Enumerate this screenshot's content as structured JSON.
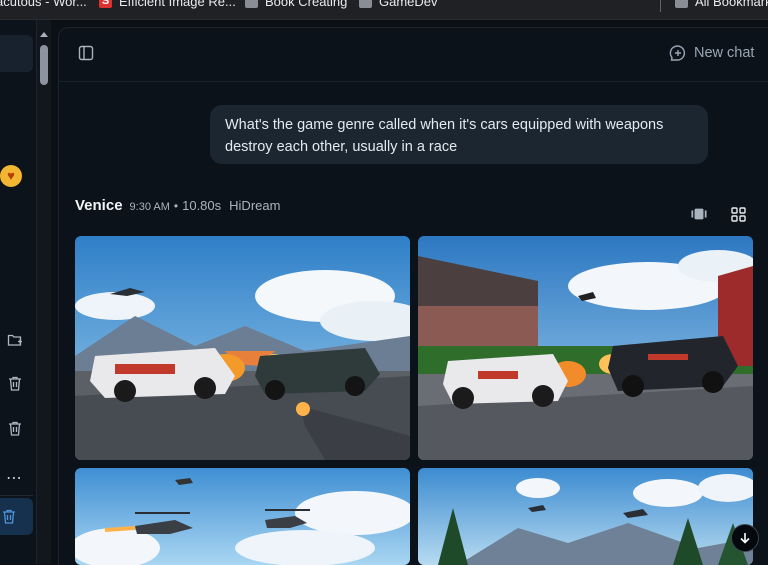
{
  "bookmarks": [
    {
      "label": "acutous - Wor...",
      "icon": "folder-icon"
    },
    {
      "label": "Efficient Image Re...",
      "icon": "s-logo-icon"
    },
    {
      "label": "Book Creating",
      "icon": "folder-icon"
    },
    {
      "label": "GameDev",
      "icon": "folder-icon"
    },
    {
      "label": "All Bookmarks",
      "icon": "folder-icon"
    }
  ],
  "header": {
    "new_chat_label": "New chat"
  },
  "user_message": "What's the game genre called when it's cars equipped with weapons destroy each other, usually in a race",
  "assistant": {
    "name": "Venice",
    "time": "9:30 AM",
    "separator": "•",
    "duration": "10.80s",
    "model": "HiDream"
  },
  "images": [
    {
      "alt": "Race cars with mounted guns racing past helicopters and explosions"
    },
    {
      "alt": "Armed race cars on a stadium racetrack with fire and sparks"
    },
    {
      "alt": "Helicopter gunships over a race scene"
    },
    {
      "alt": "Mountain race track with drones and pine trees"
    }
  ],
  "colors": {
    "accent": "#4f93d9",
    "panel": "#0c1219",
    "bubble": "#1b2630"
  }
}
